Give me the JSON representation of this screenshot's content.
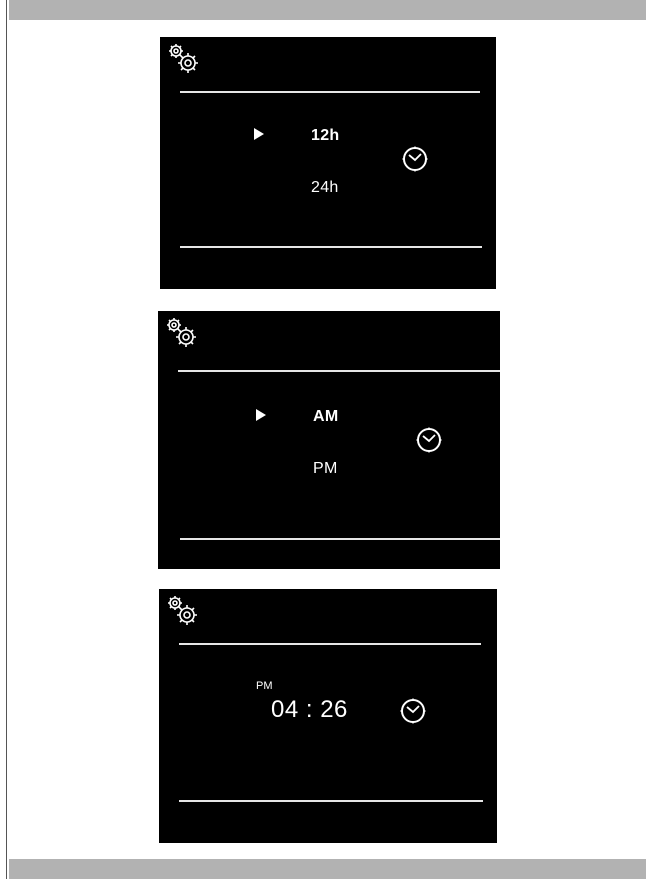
{
  "screens": [
    {
      "options": [
        {
          "label": "12h",
          "selected": true
        },
        {
          "label": "24h",
          "selected": false
        }
      ],
      "icons": [
        "settings-gears-icon",
        "clock-icon",
        "selection-arrow-icon"
      ]
    },
    {
      "options": [
        {
          "label": "AM",
          "selected": true
        },
        {
          "label": "PM",
          "selected": false
        }
      ],
      "icons": [
        "settings-gears-icon",
        "clock-icon",
        "selection-arrow-icon"
      ]
    },
    {
      "period": "PM",
      "time": "04 : 26",
      "icons": [
        "settings-gears-icon",
        "clock-icon"
      ]
    }
  ],
  "colors": {
    "screen_background": "#000000",
    "text": "#ffffff",
    "divider": "#e6e6e6",
    "frame_bar": "#b2b2b2"
  }
}
